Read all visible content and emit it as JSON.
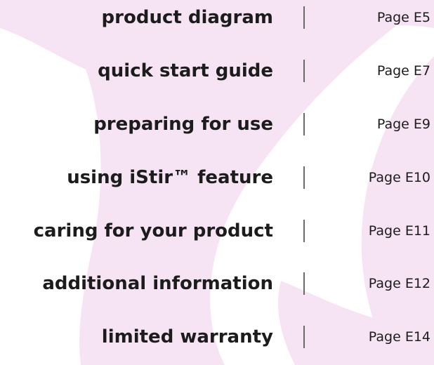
{
  "toc": {
    "entries": [
      {
        "title": "product diagram",
        "page": "Page  E5"
      },
      {
        "title": "quick start guide",
        "page": "Page  E7"
      },
      {
        "title": "preparing for use",
        "page": "Page  E9"
      },
      {
        "title": "using iStir™ feature",
        "page": "Page  E10"
      },
      {
        "title": "caring for your product",
        "page": "Page  E11"
      },
      {
        "title": "additional information",
        "page": "Page  E12"
      },
      {
        "title": "limited warranty",
        "page": "Page  E14"
      }
    ]
  },
  "colors": {
    "background": "#ffffff",
    "watermark": "#f6e4f5",
    "text": "#1c1c1c",
    "divider": "#6a6a6a"
  }
}
